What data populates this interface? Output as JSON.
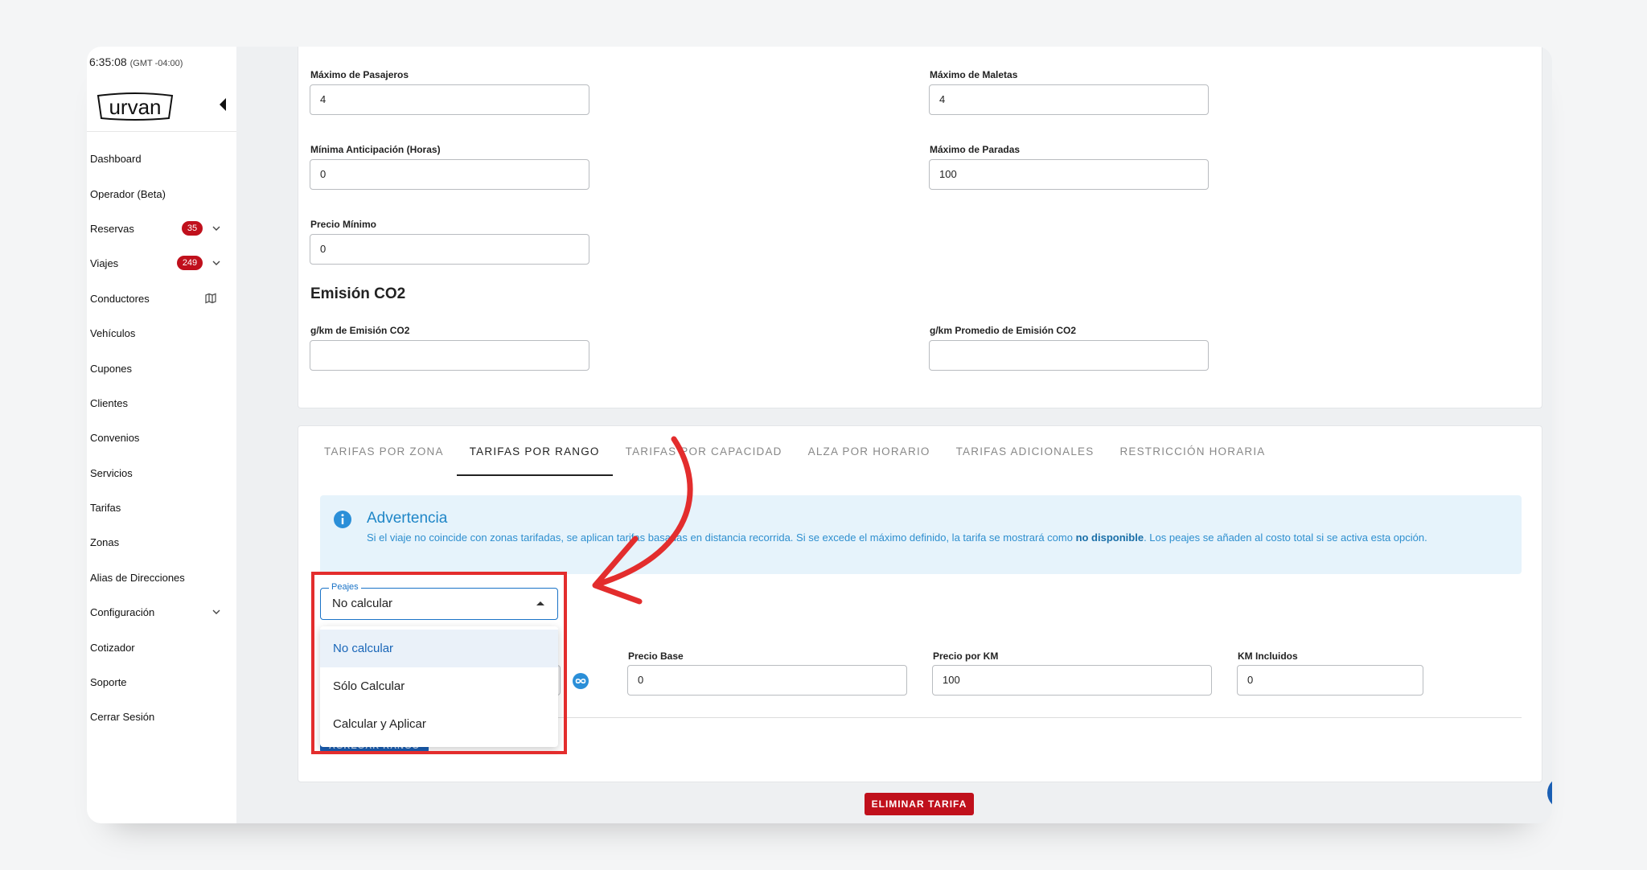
{
  "clock": {
    "time": "6:35:08",
    "timezone": "(GMT -04:00)"
  },
  "brand": {
    "logo_text": "urvan",
    "accent": "#c0101c",
    "primary": "#1a73c7"
  },
  "sidebar": {
    "items": [
      {
        "label": "Dashboard"
      },
      {
        "label": "Operador (Beta)"
      },
      {
        "label": "Reservas",
        "badge": "35"
      },
      {
        "label": "Viajes",
        "badge": "249"
      },
      {
        "label": "Conductores",
        "icon": "map-icon"
      },
      {
        "label": "Vehículos"
      },
      {
        "label": "Cupones"
      },
      {
        "label": "Clientes"
      },
      {
        "label": "Convenios"
      },
      {
        "label": "Servicios"
      },
      {
        "label": "Tarifas"
      },
      {
        "label": "Zonas"
      },
      {
        "label": "Alias de Direcciones"
      },
      {
        "label": "Configuración"
      },
      {
        "label": "Cotizador"
      },
      {
        "label": "Soporte"
      },
      {
        "label": "Cerrar Sesión"
      }
    ]
  },
  "form": {
    "max_passengers": {
      "label": "Máximo de Pasajeros",
      "value": "4"
    },
    "max_luggage": {
      "label": "Máximo de Maletas",
      "value": "4"
    },
    "min_advance": {
      "label": "Mínima Anticipación (Horas)",
      "value": "0"
    },
    "max_stops": {
      "label": "Máximo de Paradas",
      "value": "100"
    },
    "min_price": {
      "label": "Precio Mínimo",
      "value": "0"
    },
    "co2_section": "Emisión CO2",
    "co2_gkm": {
      "label": "g/km de Emisión CO2",
      "value": ""
    },
    "co2_avg": {
      "label": "g/km Promedio de Emisión CO2",
      "value": ""
    }
  },
  "tabs": [
    {
      "label": "Tarifas por Zona"
    },
    {
      "label": "Tarifas por Rango",
      "active": true
    },
    {
      "label": "Tarifas por Capacidad"
    },
    {
      "label": "Alza por Horario"
    },
    {
      "label": "Tarifas Adicionales"
    },
    {
      "label": "Restricción Horaria"
    }
  ],
  "alert": {
    "title": "Advertencia",
    "text_before": "Si el viaje no coincide con zonas tarifadas, se aplican tarifas basadas en distancia recorrida. Si se excede el máximo definido, la tarifa se mostrará como ",
    "text_bold": "no disponible",
    "text_after": ". Los peajes se añaden al costo total si se activa esta opción."
  },
  "peajes": {
    "legend": "Peajes",
    "value": "No calcular",
    "options": [
      "No calcular",
      "Sólo Calcular",
      "Calcular y Aplicar"
    ]
  },
  "range": {
    "base_price": {
      "label": "Precio Base",
      "value": "0"
    },
    "price_per_km": {
      "label": "Precio por KM",
      "value": "100"
    },
    "km_included": {
      "label": "KM Incluidos",
      "value": "0"
    },
    "add_button": "AGREGAR RANGO"
  },
  "delete_button": "ELIMINAR TARIFA",
  "annotation_color": "#e32d2d"
}
